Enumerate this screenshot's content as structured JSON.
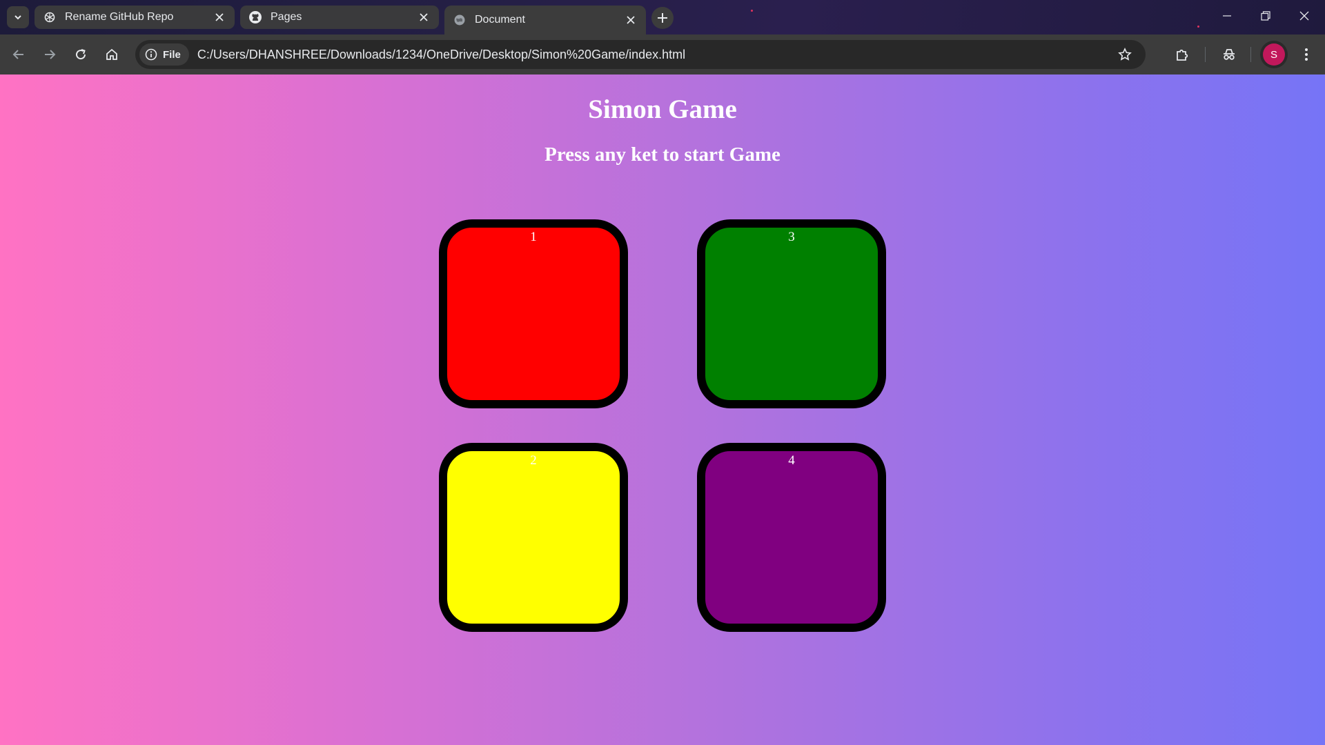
{
  "browser": {
    "tabs": [
      {
        "title": "Rename GitHub Repo",
        "icon": "chatgpt-icon",
        "active": false
      },
      {
        "title": "Pages",
        "icon": "github-icon",
        "active": false
      },
      {
        "title": "Document",
        "icon": "globe-icon",
        "active": true
      }
    ],
    "site_chip_label": "File",
    "url": "C:/Users/DHANSHREE/Downloads/1234/OneDrive/Desktop/Simon%20Game/index.html",
    "profile_initial": "S"
  },
  "page": {
    "title": "Simon Game",
    "subtitle": "Press any ket to start Game",
    "buttons": [
      {
        "label": "1",
        "color": "#ff0000"
      },
      {
        "label": "3",
        "color": "#008000"
      },
      {
        "label": "2",
        "color": "#ffff00"
      },
      {
        "label": "4",
        "color": "#800080"
      }
    ]
  },
  "colors": {
    "gradient_left": "#ff72c3",
    "gradient_right": "#7674f6",
    "profile_badge": "#c2185b"
  }
}
